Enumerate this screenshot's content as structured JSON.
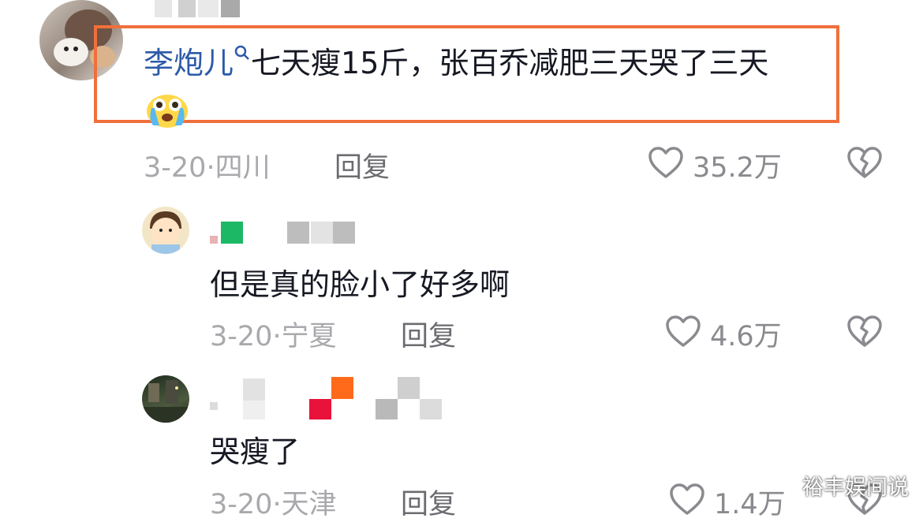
{
  "comments": [
    {
      "username": "李炮儿",
      "text": "七天瘦15斤，张百乔减肥三天哭了三天",
      "date": "3-20",
      "location": "四川",
      "reply_label": "回复",
      "likes": "35.2万"
    },
    {
      "text": "但是真的脸小了好多啊",
      "date": "3-20",
      "location": "宁夏",
      "reply_label": "回复",
      "likes": "4.6万"
    },
    {
      "text": "哭瘦了",
      "date": "3-20",
      "location": "天津",
      "reply_label": "回复",
      "likes": "1.4万"
    }
  ],
  "separator": "·",
  "watermark": "裕丰娱间说",
  "colors": {
    "highlight": "#f06f3c",
    "username": "#2c5aa8",
    "meta": "#a9a9ad"
  },
  "icons": [
    "heart-outline-icon",
    "broken-heart-icon",
    "search-icon",
    "crying-emoji-icon"
  ]
}
